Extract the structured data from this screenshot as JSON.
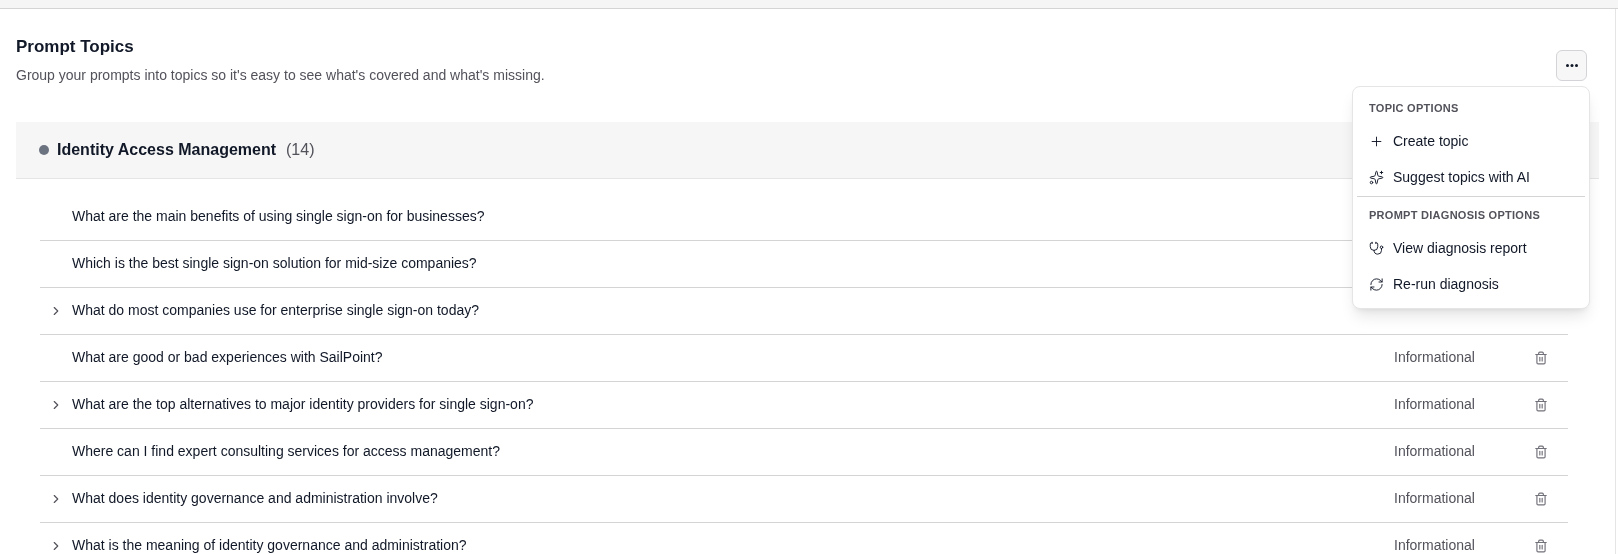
{
  "header": {
    "title": "Prompt Topics",
    "description": "Group your prompts into topics so it's easy to see what's covered and what's missing."
  },
  "topic": {
    "name": "Identity Access Management",
    "count": "(14)",
    "color": "#6b7280"
  },
  "prompts": [
    {
      "text": "What are the main benefits of using single sign-on for businesses?",
      "expandable": false
    },
    {
      "text": "Which is the best single sign-on solution for mid-size companies?",
      "expandable": false
    },
    {
      "text": "What do most companies use for enterprise single sign-on today?",
      "expandable": true
    },
    {
      "text": "What are good or bad experiences with SailPoint?",
      "expandable": false,
      "category": "Informational"
    },
    {
      "text": "What are the top alternatives to major identity providers for single sign-on?",
      "expandable": true,
      "category": "Informational"
    },
    {
      "text": "Where can I find expert consulting services for access management?",
      "expandable": false,
      "category": "Informational"
    },
    {
      "text": "What does identity governance and administration involve?",
      "expandable": true,
      "category": "Informational"
    },
    {
      "text": "What is the meaning of identity governance and administration?",
      "expandable": true,
      "category": "Informational"
    }
  ],
  "menu": {
    "sections": [
      {
        "heading": "TOPIC OPTIONS",
        "items": [
          {
            "label": "Create topic"
          },
          {
            "label": "Suggest topics with AI"
          }
        ]
      },
      {
        "heading": "PROMPT DIAGNOSIS OPTIONS",
        "items": [
          {
            "label": "View diagnosis report"
          },
          {
            "label": "Re-run diagnosis"
          }
        ]
      }
    ]
  }
}
